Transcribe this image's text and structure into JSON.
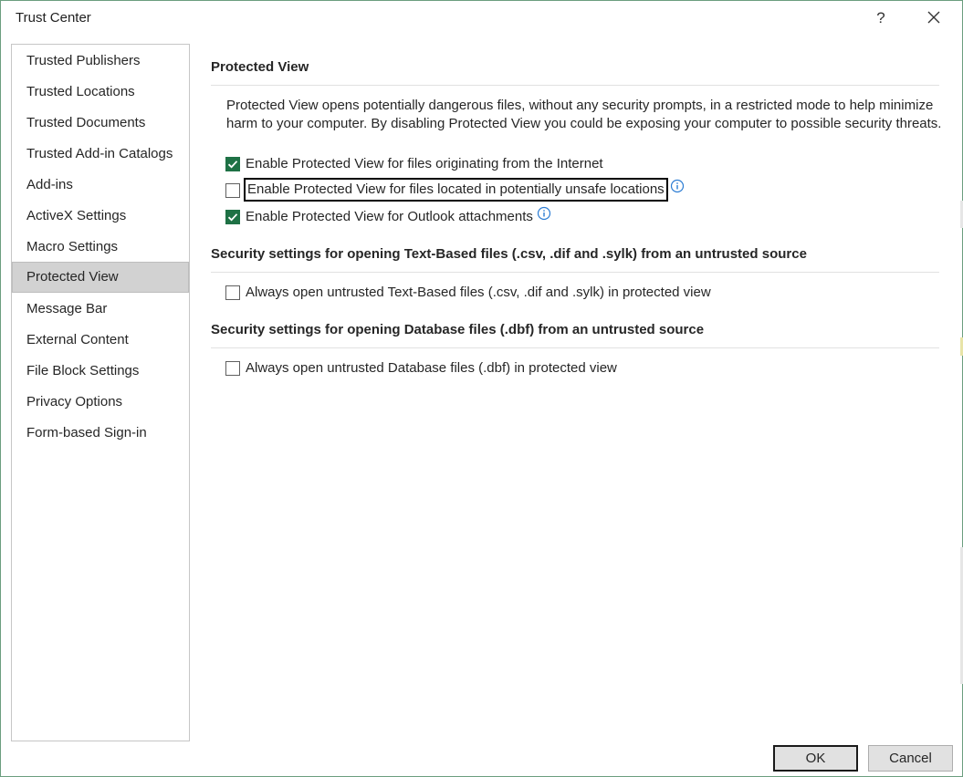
{
  "window": {
    "title": "Trust Center",
    "help_label": "?"
  },
  "sidebar": {
    "items": [
      {
        "label": "Trusted Publishers"
      },
      {
        "label": "Trusted Locations"
      },
      {
        "label": "Trusted Documents"
      },
      {
        "label": "Trusted Add-in Catalogs"
      },
      {
        "label": "Add-ins"
      },
      {
        "label": "ActiveX Settings"
      },
      {
        "label": "Macro Settings"
      },
      {
        "label": "Protected View",
        "selected": true
      },
      {
        "label": "Message Bar"
      },
      {
        "label": "External Content"
      },
      {
        "label": "File Block Settings"
      },
      {
        "label": "Privacy Options"
      },
      {
        "label": "Form-based Sign-in"
      }
    ]
  },
  "protected_view": {
    "heading": "Protected View",
    "description": "Protected View opens potentially dangerous files, without any security prompts, in a restricted mode to help minimize harm to your computer. By disabling Protected View you could be exposing your computer to possible security threats.",
    "options": [
      {
        "label": "Enable Protected View for files originating from the Internet",
        "checked": true
      },
      {
        "label": "Enable Protected View for files located in potentially unsafe locations",
        "checked": false,
        "focused": true
      },
      {
        "label": "Enable Protected View for Outlook attachments",
        "checked": true
      }
    ]
  },
  "text_based": {
    "heading": "Security settings for opening Text-Based files (.csv, .dif and .sylk) from an untrusted source",
    "option": {
      "label": "Always open untrusted Text-Based files (.csv, .dif and .sylk) in protected view",
      "checked": false
    }
  },
  "database": {
    "heading": "Security settings for opening Database files (.dbf) from an untrusted source",
    "option": {
      "label": "Always open untrusted Database files (.dbf) in protected view",
      "checked": false
    }
  },
  "footer": {
    "ok_label": "OK",
    "cancel_label": "Cancel"
  },
  "colors": {
    "accent": "#1e7145",
    "selected_bg": "#d2d2d2",
    "info": "#2b7cd3"
  }
}
